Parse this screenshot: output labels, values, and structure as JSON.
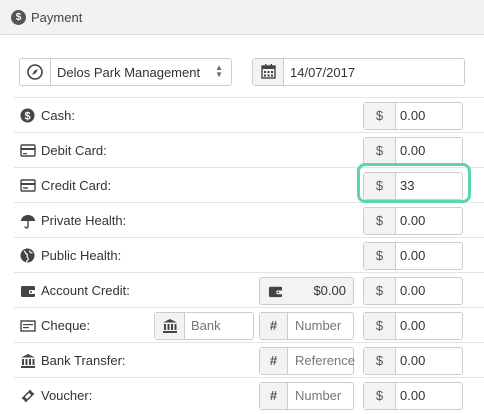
{
  "header": {
    "title": "Payment",
    "icon": "dollar-circle-icon"
  },
  "provider": {
    "selected": "Delos Park Management",
    "icon": "compass-icon"
  },
  "date": {
    "value": "14/07/2017",
    "icon": "calendar-icon"
  },
  "rows": [
    {
      "label": "Cash:",
      "icon": "dollar-circle-icon",
      "currency": "$",
      "amount": "0.00"
    },
    {
      "label": "Debit Card:",
      "icon": "card-icon",
      "currency": "$",
      "amount": "0.00"
    },
    {
      "label": "Credit Card:",
      "icon": "credit-card-icon",
      "currency": "$",
      "amount": "33"
    },
    {
      "label": "Private Health:",
      "icon": "umbrella-icon",
      "currency": "$",
      "amount": "0.00"
    },
    {
      "label": "Public Health:",
      "icon": "globe-icon",
      "currency": "$",
      "amount": "0.00"
    },
    {
      "label": "Account Credit:",
      "icon": "wallet-icon",
      "balance": "$0.00",
      "currency": "$",
      "amount": "0.00"
    },
    {
      "label": "Cheque:",
      "icon": "cheque-icon",
      "bank_placeholder": "Bank",
      "ref_prefix": "#",
      "ref_placeholder": "Number",
      "currency": "$",
      "amount": "0.00"
    },
    {
      "label": "Bank Transfer:",
      "icon": "bank-icon",
      "ref_prefix": "#",
      "ref_placeholder": "Reference",
      "currency": "$",
      "amount": "0.00"
    },
    {
      "label": "Voucher:",
      "icon": "ticket-icon",
      "ref_prefix": "#",
      "ref_placeholder": "Number",
      "currency": "$",
      "amount": "0.00"
    }
  ],
  "colors": {
    "focus_highlight": "#5dd4b0"
  }
}
